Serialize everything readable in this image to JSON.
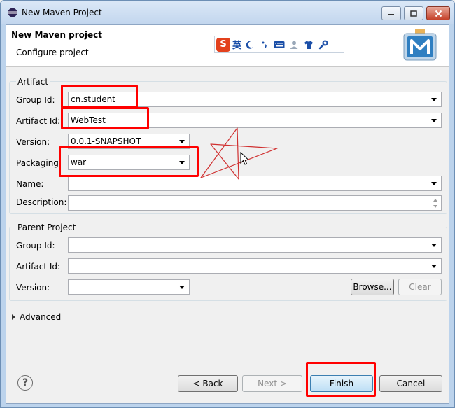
{
  "window": {
    "title": "New Maven Project"
  },
  "header": {
    "title": "New Maven project",
    "subtitle": "Configure project"
  },
  "ime": {
    "logo": "S",
    "lang": "英"
  },
  "artifact": {
    "group_label": "Artifact",
    "group_id_label": "Group Id:",
    "group_id_value": "cn.student",
    "artifact_id_label": "Artifact Id:",
    "artifact_id_value": "WebTest",
    "version_label": "Version:",
    "version_value": "0.0.1-SNAPSHOT",
    "packaging_label": "Packaging:",
    "packaging_value": "war",
    "name_label": "Name:",
    "name_value": "",
    "description_label": "Description:",
    "description_value": ""
  },
  "parent": {
    "group_label": "Parent Project",
    "group_id_label": "Group Id:",
    "group_id_value": "",
    "artifact_id_label": "Artifact Id:",
    "artifact_id_value": "",
    "version_label": "Version:",
    "version_value": "",
    "browse_label": "Browse...",
    "clear_label": "Clear"
  },
  "advanced": {
    "label": "Advanced"
  },
  "footer": {
    "help": "?",
    "back_label": "< Back",
    "next_label": "Next >",
    "finish_label": "Finish",
    "cancel_label": "Cancel"
  },
  "colors": {
    "highlight": "#ff0000",
    "annotation": "#d03030",
    "maven_blue": "#2f7fc1"
  }
}
